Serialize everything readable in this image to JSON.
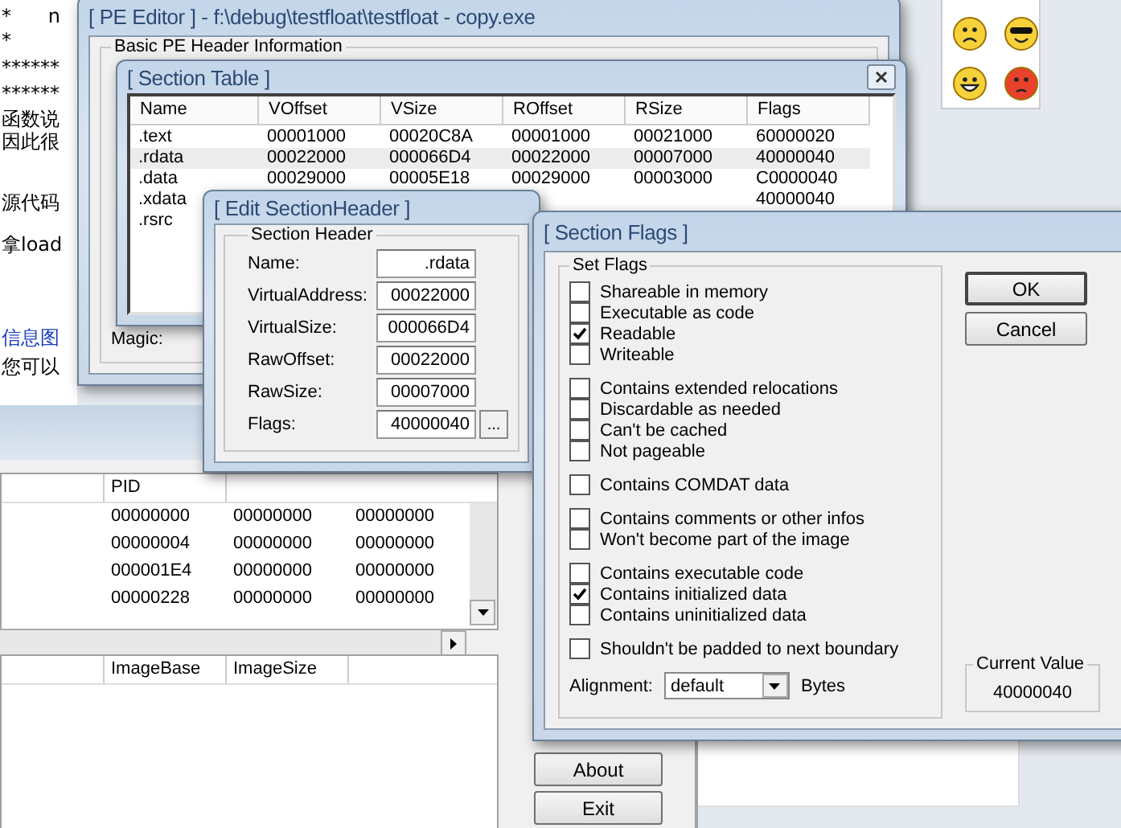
{
  "web_page": {
    "comment_marks": [
      "*      n",
      "*"
    ],
    "rule_lines": [
      "******",
      "******"
    ],
    "lines": [
      {
        "text": "函数说"
      },
      {
        "text": "因此很"
      },
      {
        "text": "源代码"
      },
      {
        "text": "拿load"
      },
      {
        "text": "信息图",
        "kind": "link"
      },
      {
        "text": "您可以"
      }
    ]
  },
  "process_window": {
    "columns": [
      "PID"
    ],
    "rows": [
      [
        "00000000",
        "00000000",
        "00000000"
      ],
      [
        "00000004",
        "00000000",
        "00000000"
      ],
      [
        "000001E4",
        "00000000",
        "00000000"
      ],
      [
        "00000228",
        "00000000",
        "00000000"
      ]
    ],
    "module_columns": [
      "ImageBase",
      "ImageSize"
    ],
    "buttons": [
      "About",
      "Exit"
    ]
  },
  "pe_editor": {
    "title": "[ PE Editor ] - f:\\debug\\testfloat\\testfloat - copy.exe",
    "group": "Basic PE Header Information",
    "magic_label": "Magic:"
  },
  "section_table": {
    "title": "[ Section Table ]",
    "columns": [
      "Name",
      "VOffset",
      "VSize",
      "ROffset",
      "RSize",
      "Flags"
    ],
    "rows": [
      {
        "cells": [
          ".text",
          "00001000",
          "00020C8A",
          "00001000",
          "00021000",
          "60000020"
        ],
        "selected": false
      },
      {
        "cells": [
          ".rdata",
          "00022000",
          "000066D4",
          "00022000",
          "00007000",
          "40000040"
        ],
        "selected": true
      },
      {
        "cells": [
          ".data",
          "00029000",
          "00005E18",
          "00029000",
          "00003000",
          "C0000040"
        ],
        "selected": false
      },
      {
        "cells": [
          ".xdata",
          null,
          null,
          null,
          null,
          "40000040"
        ],
        "selected": false
      },
      {
        "cells": [
          ".rsrc",
          null,
          null,
          null,
          null,
          null
        ],
        "selected": false
      }
    ]
  },
  "edit_section_header": {
    "title": "[ Edit SectionHeader ]",
    "group": "Section Header",
    "fields": [
      {
        "label": "Name:",
        "value": ".rdata"
      },
      {
        "label": "VirtualAddress:",
        "value": "00022000"
      },
      {
        "label": "VirtualSize:",
        "value": "000066D4"
      },
      {
        "label": "RawOffset:",
        "value": "00022000"
      },
      {
        "label": "RawSize:",
        "value": "00007000"
      },
      {
        "label": "Flags:",
        "value": "40000040",
        "button": "..."
      }
    ]
  },
  "section_flags": {
    "title": "[ Section Flags ]",
    "group": "Set Flags",
    "flag_groups": [
      [
        {
          "label": "Shareable in memory",
          "checked": false
        },
        {
          "label": "Executable as code",
          "checked": false
        },
        {
          "label": "Readable",
          "checked": true
        },
        {
          "label": "Writeable",
          "checked": false
        }
      ],
      [
        {
          "label": "Contains extended relocations",
          "checked": false
        },
        {
          "label": "Discardable as needed",
          "checked": false
        },
        {
          "label": "Can't be cached",
          "checked": false
        },
        {
          "label": "Not pageable",
          "checked": false
        }
      ],
      [
        {
          "label": "Contains COMDAT data",
          "checked": false
        }
      ],
      [
        {
          "label": "Contains comments or other infos",
          "checked": false
        },
        {
          "label": "Won't become part of the image",
          "checked": false
        }
      ],
      [
        {
          "label": "Contains executable code",
          "checked": false
        },
        {
          "label": "Contains initialized data",
          "checked": true
        },
        {
          "label": "Contains uninitialized data",
          "checked": false
        }
      ],
      [
        {
          "label": "Shouldn't be padded to next boundary",
          "checked": false
        }
      ]
    ],
    "alignment_label": "Alignment:",
    "alignment_value": "default",
    "alignment_unit": "Bytes",
    "buttons": [
      "OK",
      "Cancel"
    ],
    "current_value_label": "Current Value",
    "current_value": "40000040"
  }
}
